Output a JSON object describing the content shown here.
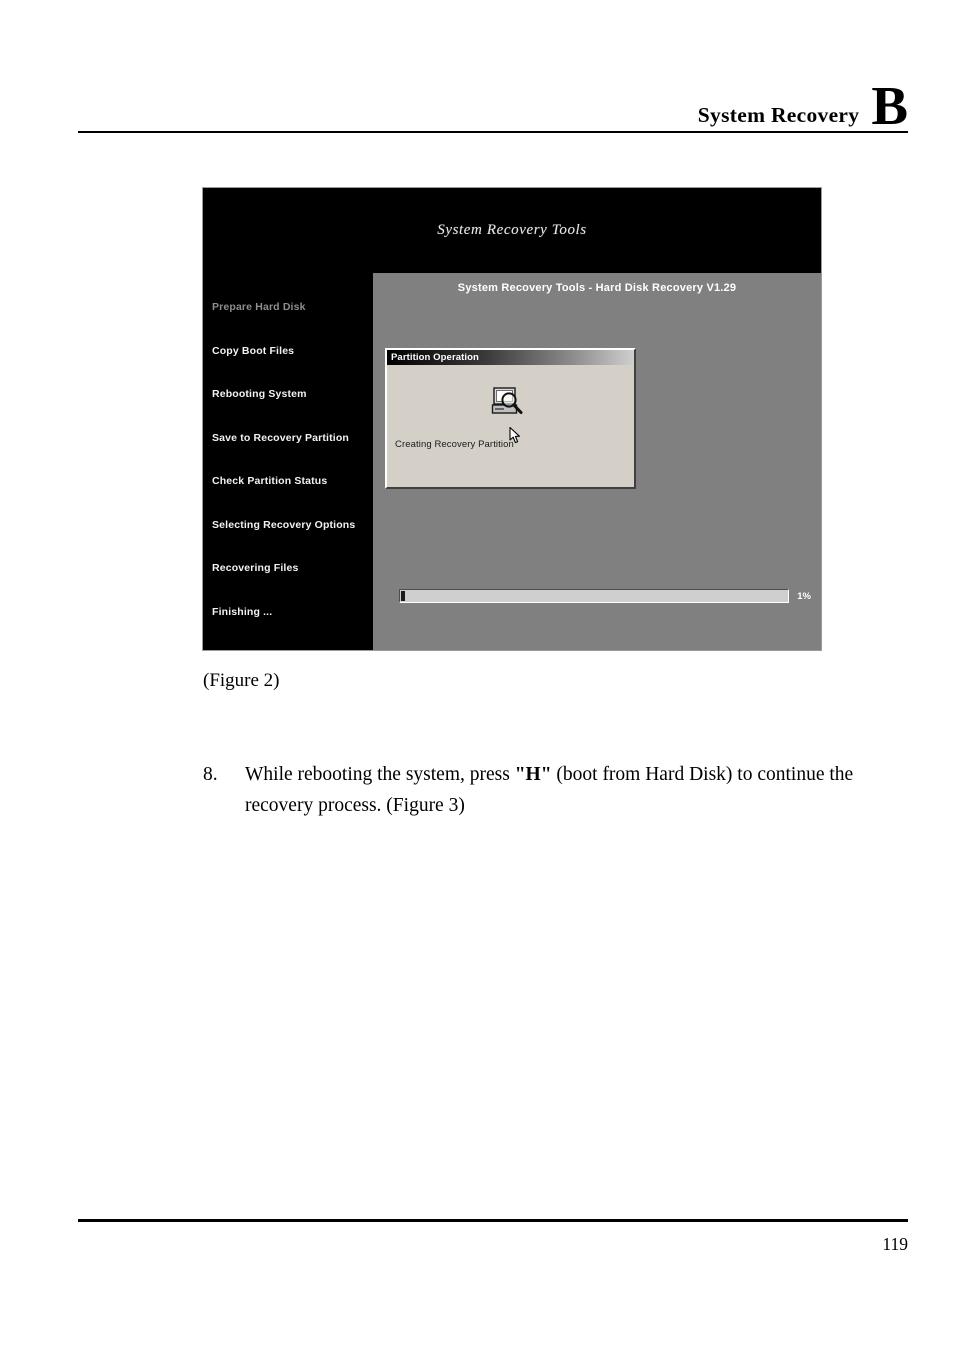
{
  "header": {
    "title": "System Recovery",
    "appendix_letter": "B"
  },
  "figure": {
    "banner_title": "System Recovery Tools",
    "sidebar": {
      "items": [
        {
          "label": "Prepare Hard Disk",
          "state": "dim"
        },
        {
          "label": "Copy Boot Files",
          "state": "normal"
        },
        {
          "label": "Rebooting System",
          "state": "normal"
        },
        {
          "label": "Save to Recovery Partition",
          "state": "normal"
        },
        {
          "label": "Check Partition Status",
          "state": "normal"
        },
        {
          "label": "Selecting Recovery Options",
          "state": "normal"
        },
        {
          "label": "Recovering Files",
          "state": "normal"
        },
        {
          "label": "Finishing ...",
          "state": "normal"
        }
      ]
    },
    "main": {
      "title": "System Recovery Tools - Hard Disk Recovery V1.29",
      "dialog": {
        "titlebar": "Partition Operation",
        "icon": "computer-search-icon",
        "cursor": "mouse-pointer-icon",
        "status": "Creating Recovery Partition"
      },
      "progress": {
        "percent_label": "1%",
        "percent_value": 1
      }
    },
    "colors": {
      "banner_background": "#000000",
      "sidebar_background": "#000000",
      "main_background": "#808080",
      "dialog_face": "#d4d0c8",
      "progress_fill": "#1c1c1c"
    }
  },
  "caption": "(Figure 2)",
  "body": {
    "item_number": "8.",
    "text_before": "While rebooting the system, press ",
    "text_bold": "\"H\"",
    "text_after": " (boot from Hard Disk) to continue the recovery process. (Figure 3)"
  },
  "footer": {
    "page_number": "119"
  }
}
